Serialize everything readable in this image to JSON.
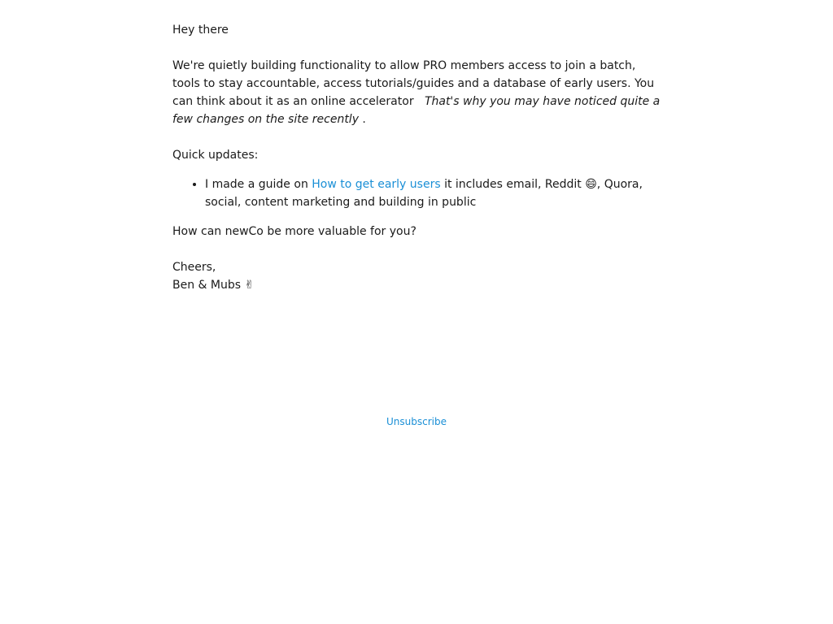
{
  "email": {
    "greeting": "Hey there",
    "intro": "We're quietly building functionality to allow PRO members access to join a batch, tools to stay accountable, access tutorials/guides and a database of early users. You can think about it as an online accelerator",
    "intro_emphasis": "That's why you may have noticed quite a few changes on the site recently",
    "updates_label": "Quick updates:",
    "update_1": "I made a guide on",
    "update_1_link": "How to get early users",
    "update_1_rest": "it includes email, Reddit 😄, Quora, social, content marketing and building in public",
    "closing_question": "How can newCo be more valuable for you?",
    "signoff": "Cheers,",
    "signature": "Ben & Mubs ✌"
  },
  "footer": {
    "unsubscribe": "Unsubscribe"
  }
}
